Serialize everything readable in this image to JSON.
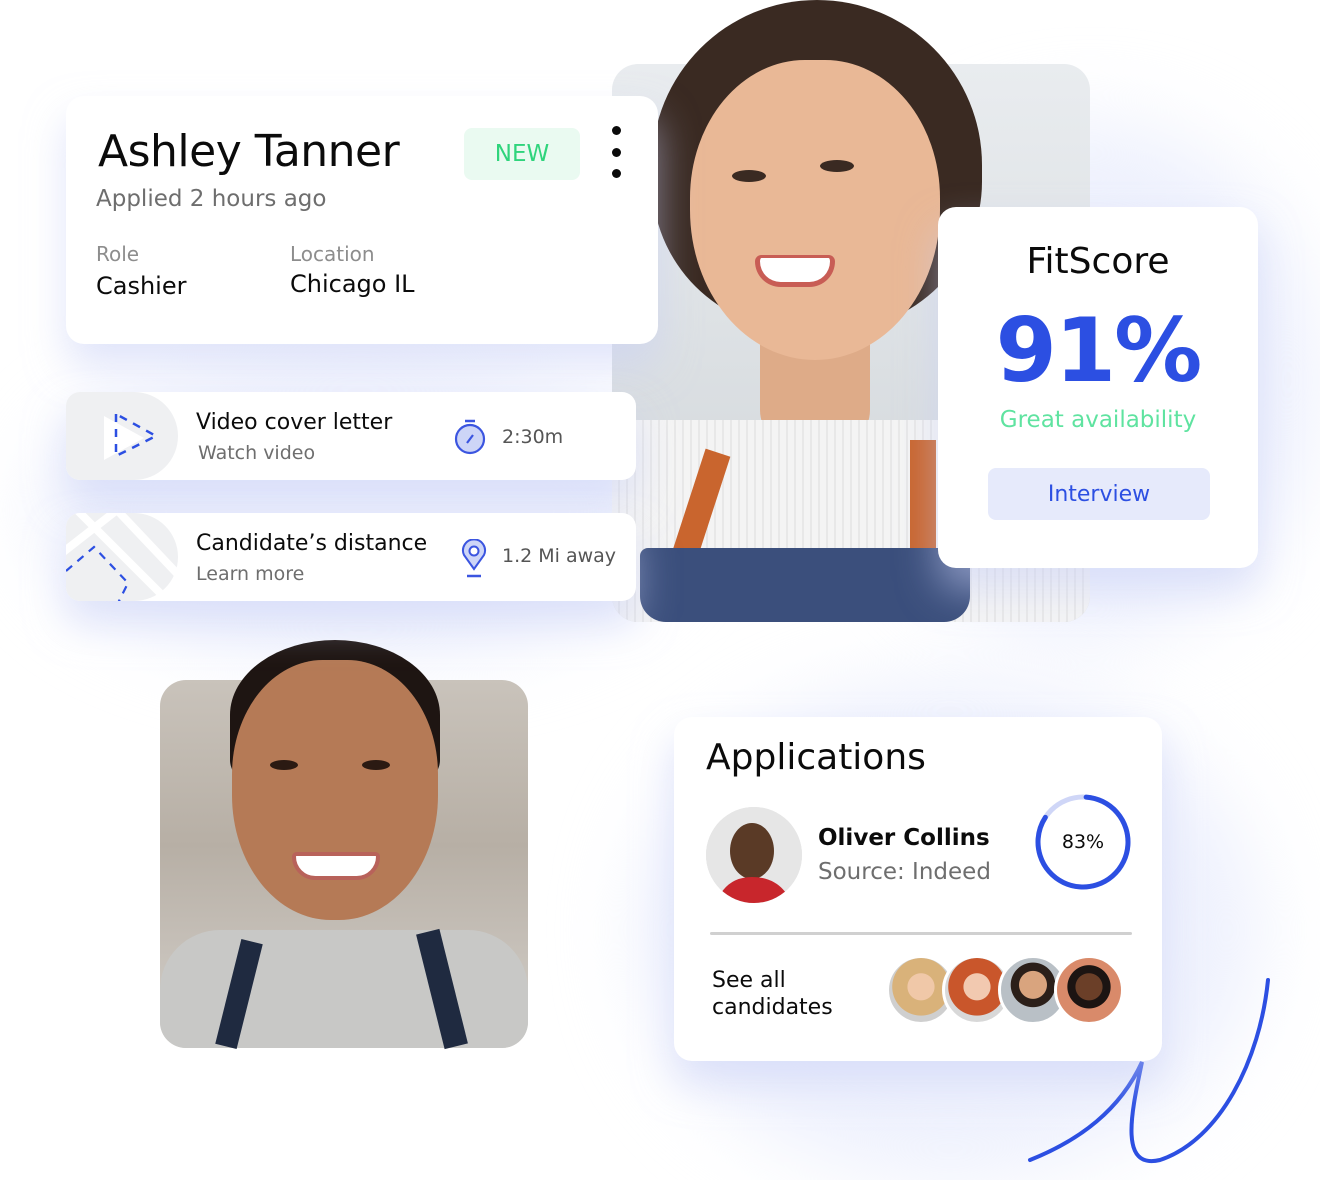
{
  "candidate": {
    "name": "Ashley Tanner",
    "applied": "Applied 2 hours ago",
    "badge": "NEW",
    "menu_icon": "kebab-menu-icon",
    "role_label": "Role",
    "role_value": "Cashier",
    "location_label": "Location",
    "location_value": "Chicago IL"
  },
  "video_row": {
    "title": "Video cover letter",
    "subtitle": "Watch video",
    "icon": "stopwatch-icon",
    "duration": "2:30m"
  },
  "distance_row": {
    "title": "Candidate’s distance",
    "subtitle": "Learn more",
    "icon": "map-pin-icon",
    "distance": "1.2 Mi away"
  },
  "fitscore": {
    "title": "FitScore",
    "value": "91%",
    "description": "Great availability",
    "button_label": "Interview"
  },
  "applications": {
    "title": "Applications",
    "applicant_name": "Oliver Collins",
    "applicant_source": "Source: Indeed",
    "match_percent": 83,
    "match_label": "83%",
    "see_all_label": "See all candidates",
    "candidate_avatars": [
      "candidate-avatar-1",
      "candidate-avatar-2",
      "candidate-avatar-3",
      "candidate-avatar-4"
    ]
  },
  "colors": {
    "brand_blue": "#2c4fe2",
    "success_green": "#2fd47c",
    "badge_bg": "#eafaf1",
    "button_bg": "#e6eafb",
    "ring_track": "#cfd6f7"
  }
}
